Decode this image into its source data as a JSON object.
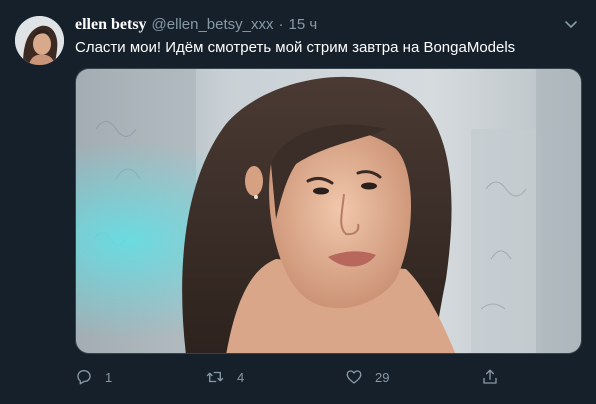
{
  "tweet": {
    "display_name": "ellen betsy",
    "handle": "@ellen_betsy_xxx",
    "separator": "·",
    "time": "15 ч",
    "text": "Сласти мои! Идём смотреть мой стрим завтра на BongaModels"
  },
  "actions": {
    "reply_count": "1",
    "retweet_count": "4",
    "like_count": "29"
  },
  "icons": {
    "reply": "reply-icon",
    "retweet": "retweet-icon",
    "like": "heart-icon",
    "share": "share-icon",
    "more": "chevron-down-icon"
  },
  "colors": {
    "background": "#15202b",
    "primary_text": "#ffffff",
    "secondary_text": "#8899a6",
    "border": "#38444d"
  }
}
